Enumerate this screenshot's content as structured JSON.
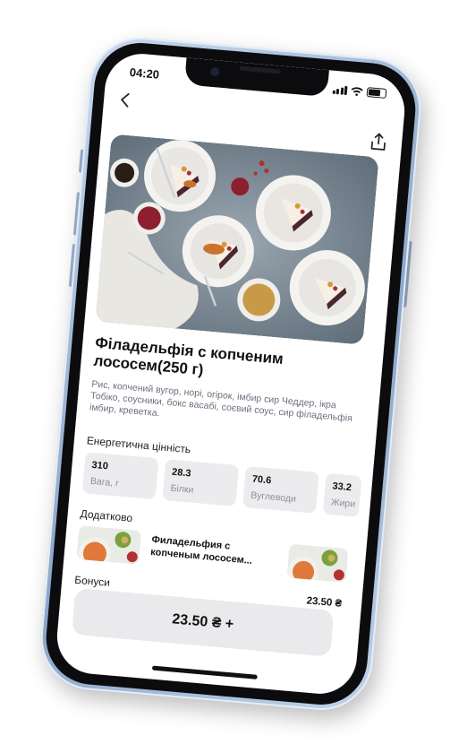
{
  "status": {
    "time": "04:20"
  },
  "product": {
    "title": "Філадельфія с копченим лососем(250 г)",
    "ingredients": "Рис, копчений вугор, норі, огірок, імбир сир Чеддер, ікра Тобіко, соусники, бокс васабі, соєвий соус, сир філадельфія імбир, креветка."
  },
  "nutrition": {
    "label": "Енергетична цінність",
    "items": [
      {
        "value": "310",
        "label": "Вага, г"
      },
      {
        "value": "28.3",
        "label": "Білки"
      },
      {
        "value": "70.6",
        "label": "Вуглеводи"
      },
      {
        "value": "33.2",
        "label": "Жири"
      }
    ]
  },
  "extras": {
    "label": "Додатково",
    "item_name": "Филадельфия с копченым лососем...",
    "price": "23.50 ₴"
  },
  "bonuses": {
    "label": "Бонуси"
  },
  "cta": {
    "label": "23.50 ₴ +"
  },
  "icons": {
    "back": "back-chevron-icon",
    "share": "share-icon"
  },
  "colors": {
    "accent_card": "#ececef",
    "text_muted": "#6b6f7b"
  }
}
